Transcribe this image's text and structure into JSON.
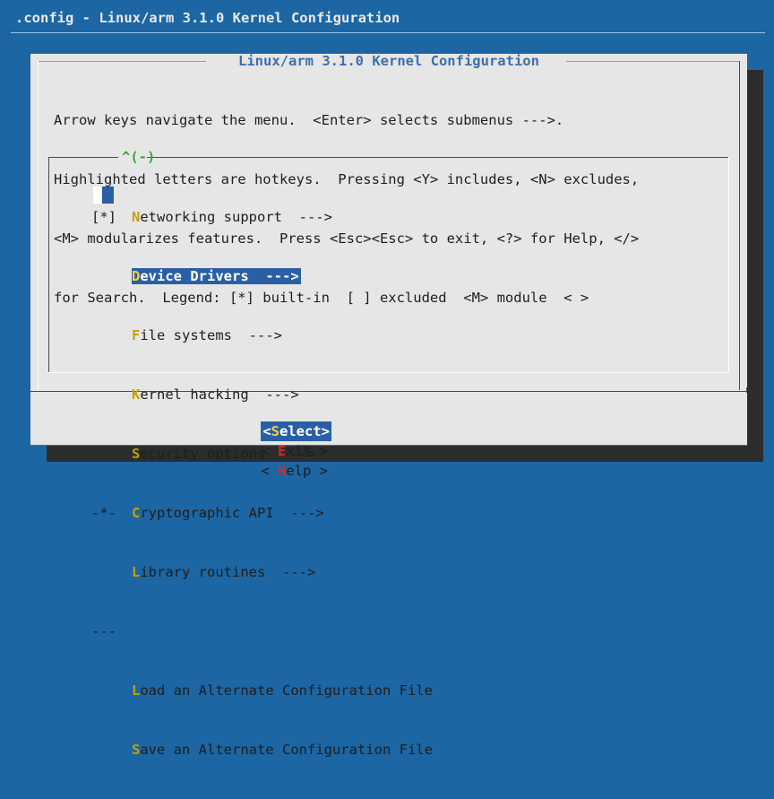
{
  "window": {
    "backtitle": ".config - Linux/arm 3.1.0 Kernel Configuration"
  },
  "dialog": {
    "title": "Linux/arm 3.1.0 Kernel Configuration",
    "help_lines": [
      "Arrow keys navigate the menu.  <Enter> selects submenus --->.",
      "Highlighted letters are hotkeys.  Pressing <Y> includes, <N> excludes,",
      "<M> modularizes features.  Press <Esc><Esc> to exit, <?> for Help, </>",
      "for Search.  Legend: [*] built-in  [ ] excluded  <M> module  < >"
    ],
    "scroll_indicator": "^(-)"
  },
  "menu": {
    "items": [
      {
        "prefix": "[*]",
        "hot": "N",
        "rest": "etworking support  --->"
      },
      {
        "prefix": "",
        "hot": "D",
        "rest": "evice Drivers  --->"
      },
      {
        "prefix": "",
        "hot": "F",
        "rest": "ile systems  --->"
      },
      {
        "prefix": "",
        "hot": "K",
        "rest": "ernel hacking  --->"
      },
      {
        "prefix": "",
        "hot": "S",
        "rest": "ecurity options  --->"
      },
      {
        "prefix": "-*-",
        "hot": "C",
        "rest": "ryptographic API  --->"
      },
      {
        "prefix": "",
        "hot": "L",
        "rest": "ibrary routines  --->"
      },
      {
        "prefix": "---",
        "hot": "",
        "rest": ""
      },
      {
        "prefix": "",
        "hot": "L",
        "rest": "oad an Alternate Configuration File"
      },
      {
        "prefix": "",
        "hot": "S",
        "rest": "ave an Alternate Configuration File"
      }
    ]
  },
  "buttons": {
    "select": {
      "open": "<",
      "hot": "S",
      "rest": "elect>"
    },
    "exit": {
      "open": "< ",
      "hot": "E",
      "rest": "xit >"
    },
    "help": {
      "open": "< ",
      "hot": "H",
      "rest": "elp >"
    }
  },
  "colors": {
    "background": "#1c66a4",
    "dialog": "#e6e6e6",
    "highlight": "#2a5fa6",
    "menu_hotkey": "#c4a000",
    "button_hotkey": "#c43030"
  }
}
